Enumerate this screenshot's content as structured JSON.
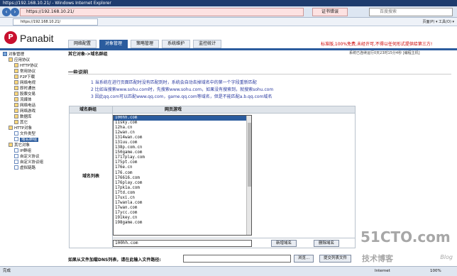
{
  "browser": {
    "title": "https://192.168.10.21/ - Windows Internet Explorer",
    "url": "https://192.168.10.21/",
    "cert_error": "证书错误",
    "search_placeholder": "百度搜索",
    "tab_label": "https://192.168.10.21/",
    "tools": "页面(P) ▾  工具(O) ▾"
  },
  "logo": {
    "mark": "P",
    "text": "Panabit"
  },
  "menu": {
    "items": [
      {
        "label": "网络配置",
        "active": false
      },
      {
        "label": "对象管理",
        "active": true
      },
      {
        "label": "策略管理",
        "active": false
      },
      {
        "label": "系统维护",
        "active": false
      },
      {
        "label": "监控统计",
        "active": false
      }
    ]
  },
  "promo": "标准版,100%免费,未经许可,不得以任何形式提供给第三方!",
  "breadcrumb": "其它对象->域名群组",
  "system_info": "系统已连续运行0天23时15分4秒 [编程主机]",
  "sidebar": {
    "items": [
      {
        "label": "对象管理",
        "level": 0,
        "icon": "folder"
      },
      {
        "label": "应用协议",
        "level": 1,
        "icon": "folder"
      },
      {
        "label": "HTTP协议",
        "level": 2,
        "icon": "folder"
      },
      {
        "label": "常用协议",
        "level": 2,
        "icon": "folder"
      },
      {
        "label": "P2P下载",
        "level": 2,
        "icon": "folder"
      },
      {
        "label": "网络电视",
        "level": 2,
        "icon": "folder"
      },
      {
        "label": "即时通信",
        "level": 2,
        "icon": "folder"
      },
      {
        "label": "股票交易",
        "level": 2,
        "icon": "folder"
      },
      {
        "label": "流媒体",
        "level": 2,
        "icon": "folder"
      },
      {
        "label": "网络电话",
        "level": 2,
        "icon": "folder"
      },
      {
        "label": "网络游戏",
        "level": 2,
        "icon": "folder"
      },
      {
        "label": "数据库",
        "level": 2,
        "icon": "folder"
      },
      {
        "label": "其它",
        "level": 2,
        "icon": "folder"
      },
      {
        "label": "HTTP对象",
        "level": 1,
        "icon": "folder"
      },
      {
        "label": "文件类型",
        "level": 2,
        "icon": "page"
      },
      {
        "label": "域名群组",
        "level": 2,
        "icon": "page",
        "selected": true
      },
      {
        "label": "其它对象",
        "level": 1,
        "icon": "folder"
      },
      {
        "label": "IP群组",
        "level": 2,
        "icon": "page"
      },
      {
        "label": "自定义协议",
        "level": 2,
        "icon": "page"
      },
      {
        "label": "自定义协议组",
        "level": 2,
        "icon": "page"
      },
      {
        "label": "虚拟链路",
        "level": 2,
        "icon": "page"
      }
    ]
  },
  "help": {
    "title": "一些说明",
    "notes": [
      "1  当系统在进行页面匹配时没有匹配到时，系统会自动去掉域名中的第一个字段重新匹配",
      "2  比如当搜索www.sohu.com时，先搜索www.sohu.com，如果没有搜索到，就搜索sohu.com",
      "3  因此qq.com可以匹配www.qq.com，game.qq.com等域名，但是不能匹配a.b.qq.com域名"
    ]
  },
  "grid": {
    "col1": "域名群组",
    "col2": "网页游戏",
    "row_label": "域名列表",
    "domains": [
      "100hh.com",
      "11sky.com",
      "12ha.cn",
      "12wan.cn",
      "1314wan.com",
      "131uu.com",
      "138p.com.cn",
      "150game.com",
      "1717play.com",
      "175pt.com",
      "176e.cn",
      "176.com",
      "176616.com",
      "176play.com",
      "17pk1a.com",
      "17td.com",
      "17uxi.cn",
      "17wanla.com",
      "17wan.com",
      "17ycc.com",
      "191key.cn",
      "198game.com",
      "",
      "",
      "",
      ""
    ],
    "selected_index": 0,
    "edit_value": "100hh.com",
    "add_button": "新增域名",
    "delete_button": "删除域名"
  },
  "import": {
    "label": "如果从文件加载DNS列表，请在此输入文件路径:",
    "browse": "浏览...",
    "submit": "提交列表文件"
  },
  "status": {
    "left": "完成",
    "zone": "Internet",
    "zoom": "100%"
  },
  "watermark": {
    "big": "51CTO.com",
    "sub": "技术博客",
    "blog": "Blog"
  }
}
